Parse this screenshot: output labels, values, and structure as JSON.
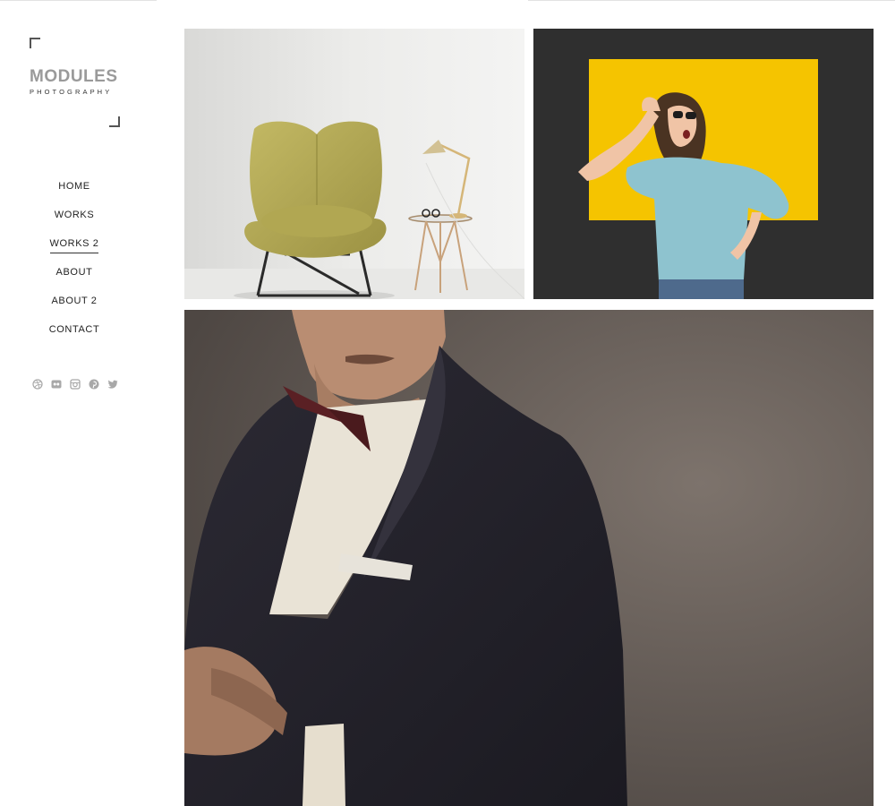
{
  "brand": {
    "name": "MODULES",
    "tagline": "PHOTOGRAPHY"
  },
  "nav": {
    "items": [
      {
        "label": "HOME"
      },
      {
        "label": "WORKS"
      },
      {
        "label": "WORKS 2",
        "active": true
      },
      {
        "label": "ABOUT"
      },
      {
        "label": "ABOUT 2"
      },
      {
        "label": "CONTACT"
      }
    ]
  },
  "social": [
    "dribbble-icon",
    "flickr-icon",
    "instagram-icon",
    "pinterest-icon",
    "twitter-icon"
  ],
  "gallery": {
    "photos": [
      {
        "subject": "chair-lamp-side-table"
      },
      {
        "subject": "woman-sunglasses-yellow-backdrop"
      },
      {
        "subject": "man-tuxedo-bow-tie"
      }
    ]
  },
  "colors": {
    "accent_yellow": "#f5c400",
    "chair_olive": "#b7ad55",
    "sweater_blue": "#8ec3cf",
    "social_gray": "#a8a8a8"
  }
}
